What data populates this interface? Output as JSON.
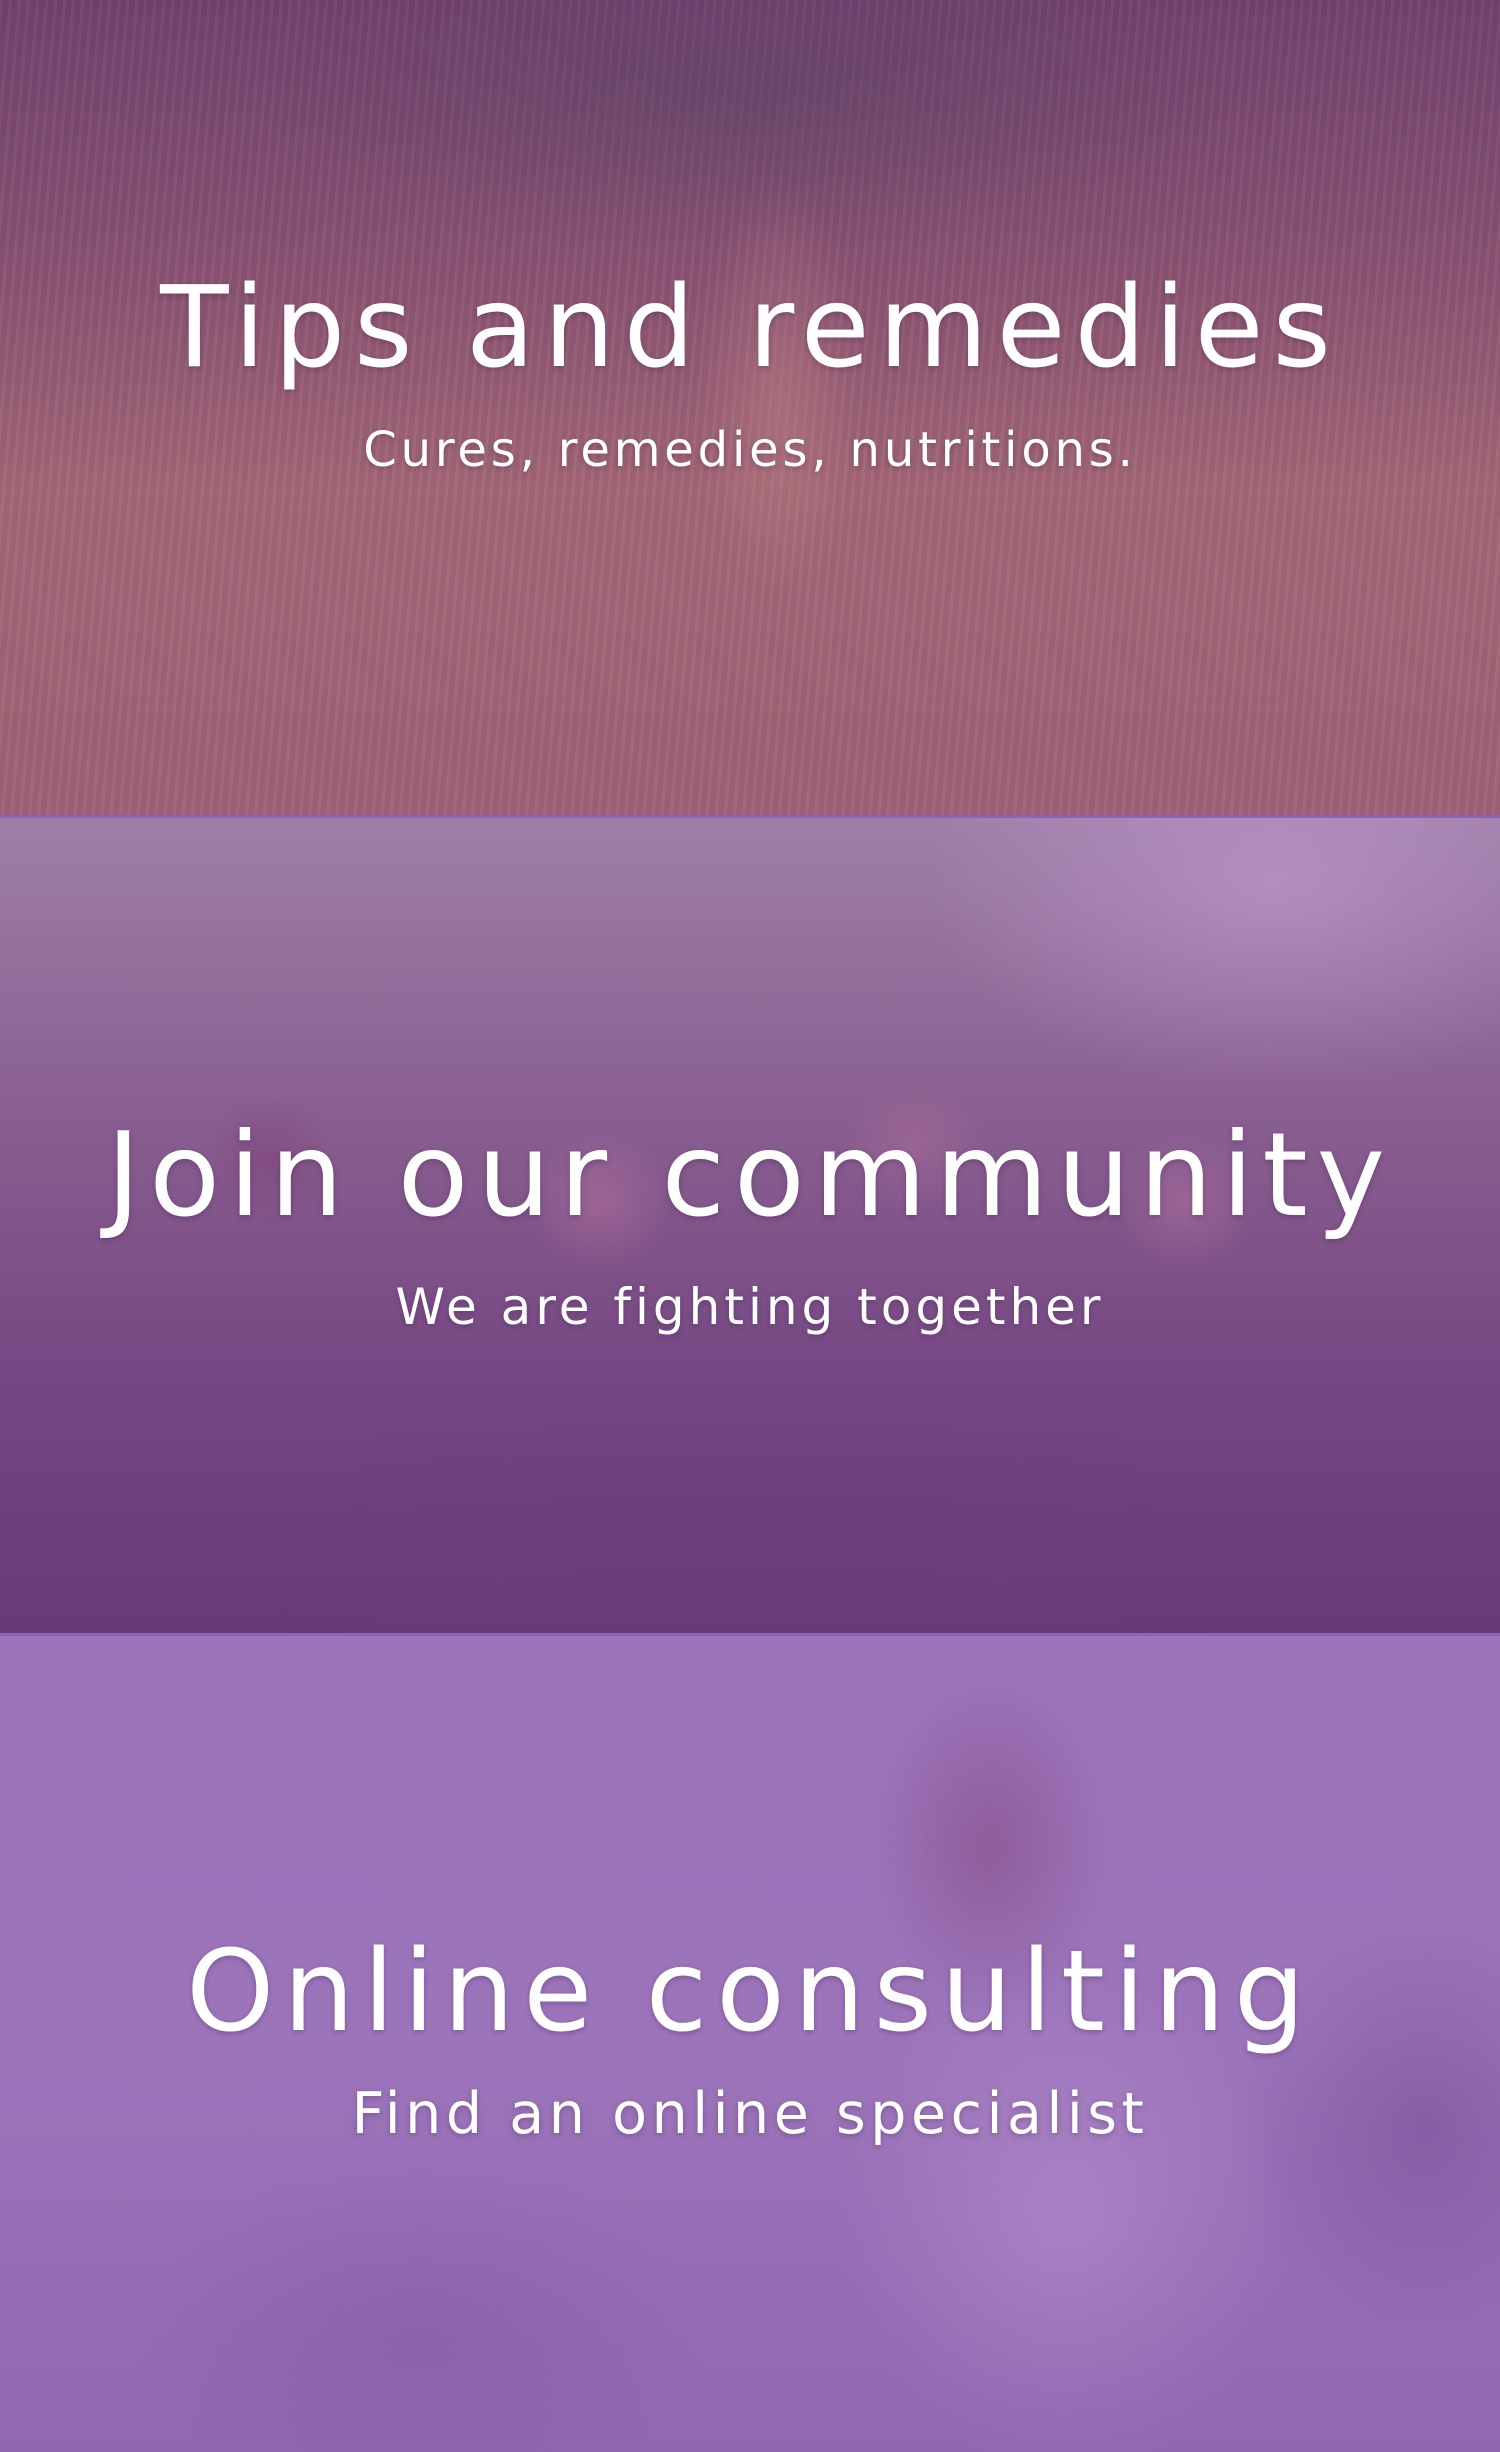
{
  "sections": [
    {
      "title": "Tips and remedies",
      "subtitle": "Cures, remedies, nutritions."
    },
    {
      "title": "Join our community",
      "subtitle": "We are fighting together"
    },
    {
      "title": "Online consulting",
      "subtitle": "Find an online specialist"
    }
  ],
  "colors": {
    "overlay": "#8a5bb3",
    "text": "#ffffff"
  }
}
